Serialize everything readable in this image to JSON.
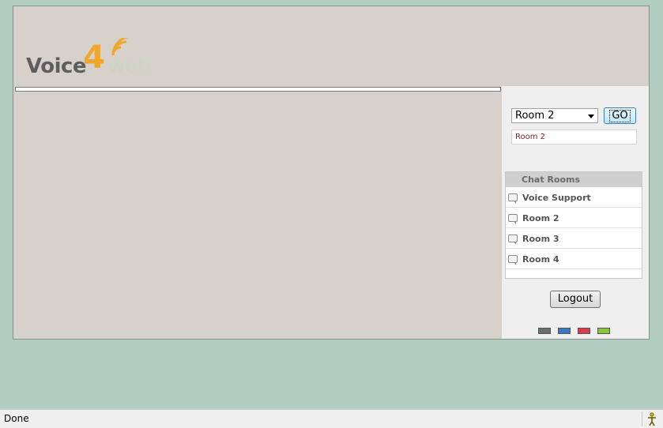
{
  "logo": {
    "part1": "Voice",
    "part2": "4",
    "part3": "web"
  },
  "room_selector": {
    "selected": "Room 2",
    "go_label": "GO"
  },
  "current_room": "Room 2",
  "chat_rooms": {
    "header": "Chat Rooms",
    "items": [
      {
        "label": "Voice Support"
      },
      {
        "label": "Room 2"
      },
      {
        "label": "Room 3"
      },
      {
        "label": "Room 4"
      }
    ]
  },
  "logout_label": "Logout",
  "theme_swatches": [
    {
      "name": "gray",
      "color": "#6b6f72"
    },
    {
      "name": "blue",
      "color": "#3b78c2"
    },
    {
      "name": "red",
      "color": "#d83c4c"
    },
    {
      "name": "green",
      "color": "#8cc63f"
    }
  ],
  "status_bar": {
    "text": "Done"
  },
  "colors": {
    "page_background": "#b2cdc1",
    "app_background": "#d6d1cb",
    "sidebar_background": "#efefef",
    "logo_orange": "#f0a72a",
    "current_room_text": "#8b1a1a"
  }
}
